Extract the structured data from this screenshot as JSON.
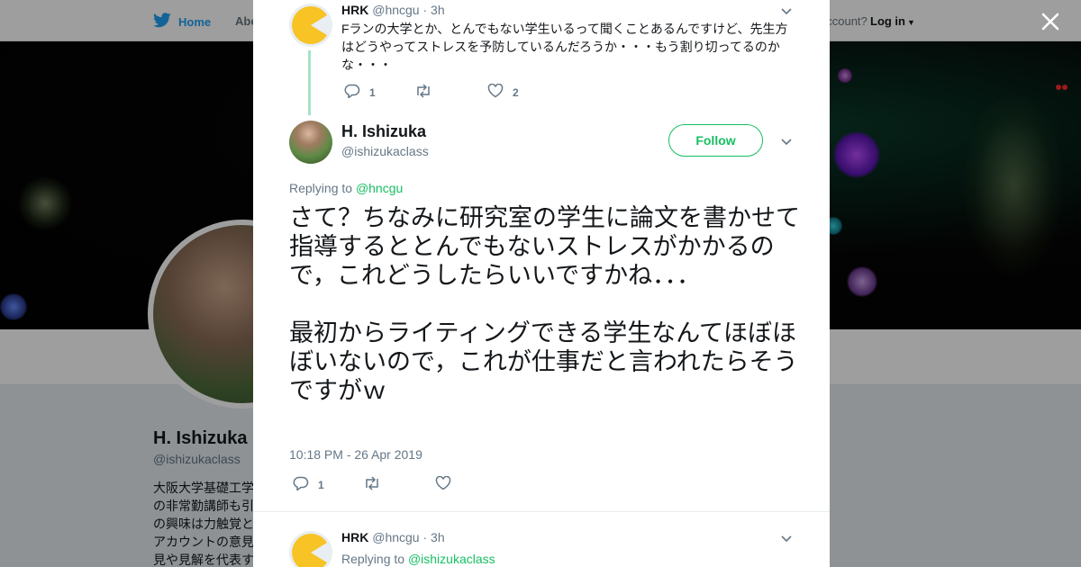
{
  "topbar": {
    "home_label": "Home",
    "about_label": "Abo",
    "account_text": "account?",
    "login_label": "Log in"
  },
  "profile": {
    "name": "H. Ishizuka",
    "handle": "@ishizukaclass",
    "bio": "大阪大学基礎工学\nの非常勤講師も引\nの興味は力触覚と\nアカウントの意見\n見や見解を代表す"
  },
  "colors": {
    "accent": "#17bf63",
    "link_blue": "#1da1f2",
    "text": "#14171a",
    "muted": "#657786",
    "thread_line": "#a4e3c4"
  },
  "parent_tweet": {
    "name": "HRK",
    "handle": "@hncgu",
    "time": "3h",
    "text": "Fランの大学とか、とんでもない学生いるって聞くことあるんですけど、先生方はどうやってストレスを予防しているんだろうか・・・もう割り切ってるのかな・・・",
    "reply_count": "1",
    "retweet_count": "",
    "like_count": "2"
  },
  "main_tweet": {
    "name": "H. Ishizuka",
    "handle": "@ishizukaclass",
    "follow_label": "Follow",
    "replying_prefix": "Replying to",
    "replying_to": "@hncgu",
    "text": "さて？ちなみに研究室の学生に論文を書かせて指導するととんでもないストレスがかかるので，これどうしたらいいですかね．．．\n\n最初からライティングできる学生なんてほぼほぼいないので，これが仕事だと言われたらそうですがｗ",
    "timestamp": "10:18 PM - 26 Apr 2019",
    "reply_count": "1",
    "retweet_count": "",
    "like_count": ""
  },
  "reply_tweet": {
    "name": "HRK",
    "handle": "@hncgu",
    "time": "3h",
    "replying_prefix": "Replying to",
    "replying_to": "@ishizukaclass"
  },
  "icons": [
    "twitter-bird-icon",
    "close-icon",
    "chevron-down-icon",
    "reply-icon",
    "retweet-icon",
    "heart-icon"
  ]
}
